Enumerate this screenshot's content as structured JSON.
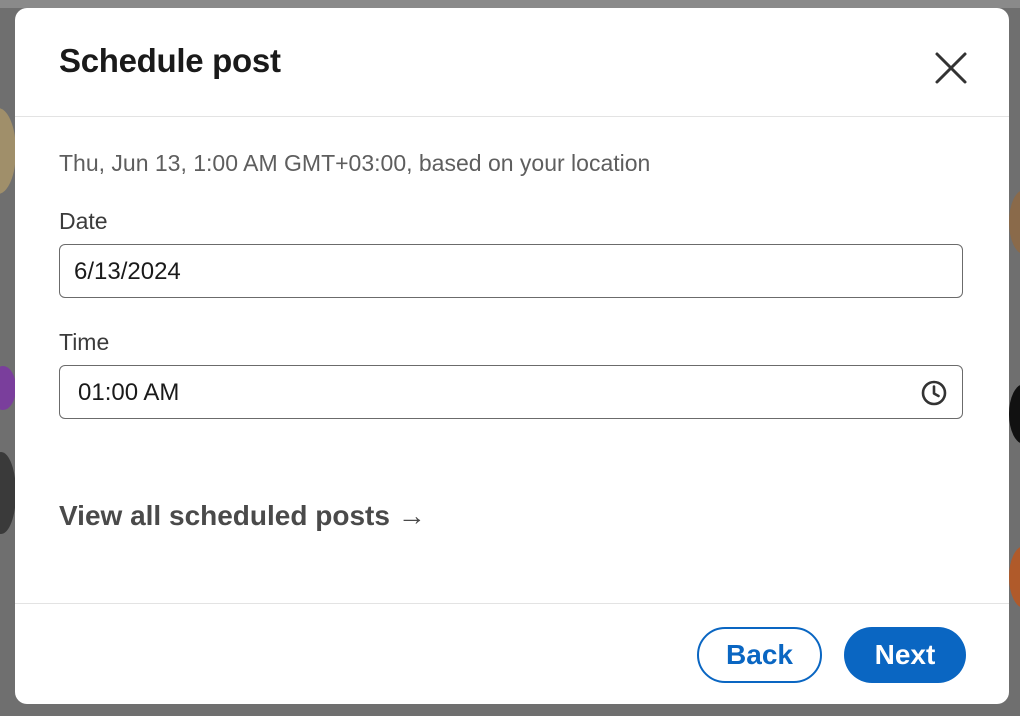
{
  "dialog": {
    "title": "Schedule post",
    "close_icon": "close-icon",
    "subtitle": "Thu, Jun 13, 1:00 AM GMT+03:00, based on your location",
    "date": {
      "label": "Date",
      "value": "6/13/2024"
    },
    "time": {
      "label": "Time",
      "value": "01:00 AM",
      "icon": "clock-icon"
    },
    "view_all_link": "View all scheduled posts →",
    "buttons": {
      "back": "Back",
      "next": "Next"
    }
  },
  "colors": {
    "accent": "#0a66c2",
    "backdrop": "#6f6f6f",
    "dialog_bg": "#ffffff",
    "input_border": "#6b6b6b"
  }
}
